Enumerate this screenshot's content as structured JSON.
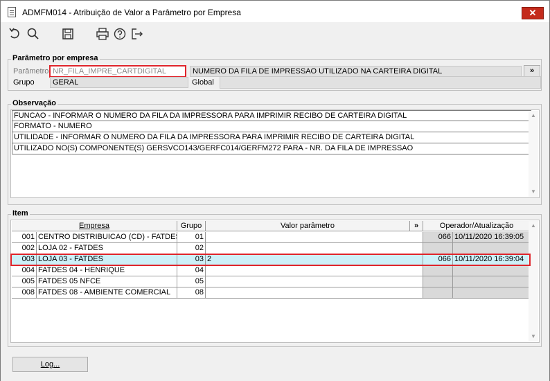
{
  "window": {
    "title": "ADMFM014 - Atribuição de Valor a Parâmetro por Empresa",
    "close_label": "✕"
  },
  "toolbar": {
    "icons": [
      "undo-icon",
      "search-icon",
      "save-icon",
      "print-icon",
      "help-icon",
      "exit-icon"
    ]
  },
  "param_group": {
    "title": "Parâmetro por empresa",
    "parametro_label": "Parâmetro",
    "parametro_value": "NR_FILA_IMPRE_CARTDIGITAL",
    "descricao_value": "NUMERO DA FILA DE IMPRESSAO UTILIZADO NA CARTEIRA DIGITAL",
    "expand_label": "»",
    "grupo_label": "Grupo",
    "grupo_value": "GERAL",
    "global_label": "Global",
    "global_value": ""
  },
  "observacao": {
    "title": "Observação",
    "lines": [
      "FUNCAO - INFORMAR O NUMERO DA FILA DA IMPRESSORA PARA IMPRIMIR RECIBO DE CARTEIRA DIGITAL",
      "FORMATO - NUMERO",
      "UTILIDADE - INFORMAR O NUMERO DA FILA DA IMPRESSORA PARA IMPRIMIR RECIBO DE CARTEIRA DIGITAL",
      "UTILIZADO NO(S) COMPONENTE(S) GERSVCO143/GERFC014/GERFM272 PARA  - NR. DA FILA DE IMPRESSAO"
    ]
  },
  "item": {
    "title": "Item",
    "headers": {
      "empresa": "Empresa",
      "grupo": "Grupo",
      "valor": "Valor parâmetro",
      "expand": "»",
      "operador": "Operador/Atualização"
    },
    "rows": [
      {
        "code": "001",
        "empresa": "CENTRO DISTRIBUICAO (CD) - FATDES",
        "grupo": "01",
        "valor": "",
        "operador": "066",
        "data": "10/11/2020 16:39:05"
      },
      {
        "code": "002",
        "empresa": "LOJA 02 - FATDES",
        "grupo": "02",
        "valor": "",
        "operador": "",
        "data": ""
      },
      {
        "code": "003",
        "empresa": "LOJA 03 - FATDES",
        "grupo": "03",
        "valor": "2",
        "operador": "066",
        "data": "10/11/2020 16:39:04"
      },
      {
        "code": "004",
        "empresa": "FATDES 04 - HENRIQUE",
        "grupo": "04",
        "valor": "",
        "operador": "",
        "data": ""
      },
      {
        "code": "005",
        "empresa": "FATDES 05 NFCE",
        "grupo": "05",
        "valor": "",
        "operador": "",
        "data": ""
      },
      {
        "code": "008",
        "empresa": "FATDES 08 - AMBIENTE COMERCIAL",
        "grupo": "08",
        "valor": "",
        "operador": "",
        "data": ""
      }
    ],
    "selected_row": 2
  },
  "footer": {
    "log_label": "Log..."
  },
  "colors": {
    "highlight": "#e0242b",
    "selected_row": "#cdf0f8",
    "close": "#c42b1c"
  }
}
